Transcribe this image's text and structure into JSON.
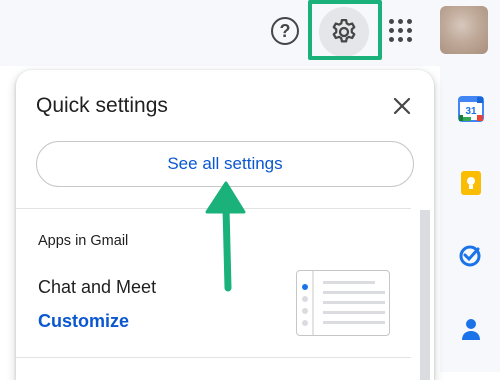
{
  "header": {
    "help_icon": "help-circle-icon",
    "settings_icon": "gear-icon",
    "apps_icon": "apps-grid-icon",
    "help_glyph": "?"
  },
  "quick_settings": {
    "title": "Quick settings",
    "see_all_label": "See all settings",
    "section_label": "Apps in Gmail",
    "row_title": "Chat and Meet",
    "customize_label": "Customize"
  },
  "side_panel": {
    "apps": [
      "calendar-icon",
      "keep-icon",
      "tasks-icon",
      "contacts-icon"
    ],
    "calendar_day": "31"
  },
  "colors": {
    "highlight": "#1bb17a",
    "link": "#0b57d0"
  }
}
